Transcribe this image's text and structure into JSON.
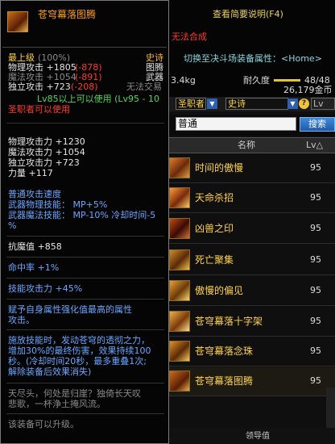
{
  "right_panel": {
    "desc_link": "查看简要说明(F4)",
    "cannot_synth": "无法合成",
    "switch_attr": "切换至决斗场装备属性：<Home>",
    "weight": "3.4kg",
    "durability_label": "耐久度",
    "durability_value": "48/48",
    "price": "26,179金币"
  },
  "filter": {
    "job": "圣职者",
    "rarity": "史诗",
    "lv_label": "Lv"
  },
  "search": {
    "value": "普通",
    "button": "搜索"
  },
  "columns": {
    "name": "名称",
    "lv": "Lv△"
  },
  "items": [
    {
      "name": "时间的傲慢",
      "lv": "95"
    },
    {
      "name": "天命杀招",
      "lv": "95"
    },
    {
      "name": "凶兽之印",
      "lv": "95"
    },
    {
      "name": "死亡聚集",
      "lv": "95"
    },
    {
      "name": "傲慢的偏见",
      "lv": "95"
    },
    {
      "name": "苍穹幕落十字架",
      "lv": "95"
    },
    {
      "name": "苍穹幕落念珠",
      "lv": "95"
    },
    {
      "name": "苍穹幕落图腾",
      "lv": "95"
    }
  ],
  "pager": {
    "label": "领导值"
  },
  "tooltip": {
    "title": "苍穹幕落图腾",
    "max_level": "最上级",
    "max_level_pct": "(100%)",
    "rarity": "史诗",
    "phys_atk": "物理攻击 +1805",
    "phys_atk_diff": "(-878)",
    "type1": "图腾",
    "mag_atk": "魔法攻击 +1054",
    "mag_atk_diff": "(-891)",
    "type2": "武器",
    "ind_atk": "独立攻击 +723",
    "ind_atk_diff": "(-208)",
    "trade": "无法交易",
    "level_req": "Lv85以上可以使用 (Lv95 - 10",
    "job_req": "圣职者可以使用",
    "stat1": "物理攻击力 +1230",
    "stat2": "魔法攻击力 +1054",
    "stat3": "独立攻击力 +723",
    "stat4": "力量 +117",
    "atk_speed": "普通攻击速度",
    "skill_phys": "武器物理技能： MP+5%",
    "skill_mag": "武器魔法技能： MP-10% 冷却时间-5",
    "skill_mag2": "%",
    "resist": "抗魔值 +858",
    "hit": "命中率 +1%",
    "skill_atk": "技能攻击力 +45%",
    "elem1": "赋予自身属性强化值最高的属性",
    "elem2": "攻击。",
    "proc1": "施放技能时，发动苍穹的透彻之力，",
    "proc2": "增加30%的最终伤害，效果持续100",
    "proc3": "秒。(冷却时间20秒，最多重叠1次;",
    "proc4": "解除装备后效果消失)",
    "flavor1": "天尽头，何处是归崖？独倚长天叹",
    "flavor2": "悲歌，一杯浄土掩风流。",
    "upgrade": "该装备可以升级。"
  },
  "colors": {
    "accent": "#ffd24a",
    "rarity": "#ff9a1f",
    "warn": "#ff3a2a"
  }
}
